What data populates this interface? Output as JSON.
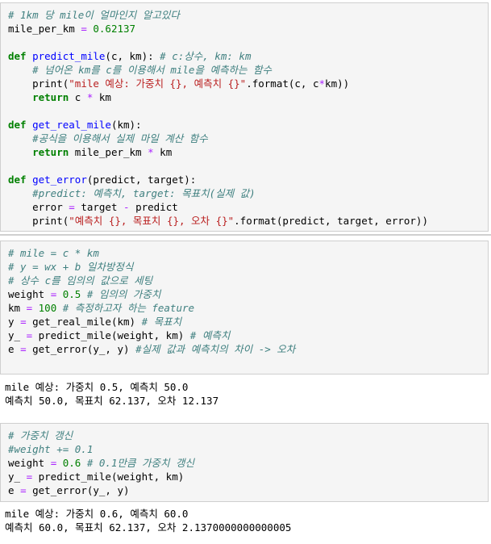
{
  "cells": [
    {
      "lines": [
        [
          {
            "t": "# 1km 당 mile이 얼마인지 알고있다",
            "c": "c"
          }
        ],
        [
          {
            "t": "mile_per_km ",
            "c": ""
          },
          {
            "t": "=",
            "c": "o"
          },
          {
            "t": " ",
            "c": ""
          },
          {
            "t": "0.62137",
            "c": "num"
          }
        ],
        [
          {
            "t": "",
            "c": ""
          }
        ],
        [
          {
            "t": "def",
            "c": "k"
          },
          {
            "t": " ",
            "c": ""
          },
          {
            "t": "predict_mile",
            "c": "n"
          },
          {
            "t": "(c, km): ",
            "c": ""
          },
          {
            "t": "# c:상수, km: km",
            "c": "c"
          }
        ],
        [
          {
            "t": "    ",
            "c": ""
          },
          {
            "t": "# 넘어온 km를 c를 이용해서 mile을 예측하는 함수",
            "c": "c"
          }
        ],
        [
          {
            "t": "    print(",
            "c": ""
          },
          {
            "t": "\"mile 예상: 가중치 {}, 예측치 {}\"",
            "c": "s"
          },
          {
            "t": ".format(c, c",
            "c": ""
          },
          {
            "t": "*",
            "c": "o"
          },
          {
            "t": "km))",
            "c": ""
          }
        ],
        [
          {
            "t": "    ",
            "c": ""
          },
          {
            "t": "return",
            "c": "k"
          },
          {
            "t": " c ",
            "c": ""
          },
          {
            "t": "*",
            "c": "o"
          },
          {
            "t": " km",
            "c": ""
          }
        ],
        [
          {
            "t": "",
            "c": ""
          }
        ],
        [
          {
            "t": "def",
            "c": "k"
          },
          {
            "t": " ",
            "c": ""
          },
          {
            "t": "get_real_mile",
            "c": "n"
          },
          {
            "t": "(km):",
            "c": ""
          }
        ],
        [
          {
            "t": "    ",
            "c": ""
          },
          {
            "t": "#공식을 이용해서 실제 마일 계산 함수",
            "c": "c"
          }
        ],
        [
          {
            "t": "    ",
            "c": ""
          },
          {
            "t": "return",
            "c": "k"
          },
          {
            "t": " mile_per_km ",
            "c": ""
          },
          {
            "t": "*",
            "c": "o"
          },
          {
            "t": " km",
            "c": ""
          }
        ],
        [
          {
            "t": "",
            "c": ""
          }
        ],
        [
          {
            "t": "def",
            "c": "k"
          },
          {
            "t": " ",
            "c": ""
          },
          {
            "t": "get_error",
            "c": "n"
          },
          {
            "t": "(predict, target):",
            "c": ""
          }
        ],
        [
          {
            "t": "    ",
            "c": ""
          },
          {
            "t": "#predict: 예측치, target: 목표치(실제 값)",
            "c": "c"
          }
        ],
        [
          {
            "t": "    error ",
            "c": ""
          },
          {
            "t": "=",
            "c": "o"
          },
          {
            "t": " target ",
            "c": ""
          },
          {
            "t": "-",
            "c": "o"
          },
          {
            "t": " predict",
            "c": ""
          }
        ],
        [
          {
            "t": "    print(",
            "c": ""
          },
          {
            "t": "\"예측치 {}, 목표치 {}, 오차 {}\"",
            "c": "s"
          },
          {
            "t": ".format(predict, target, error))",
            "c": ""
          }
        ]
      ],
      "output": []
    },
    {
      "lines": [
        [
          {
            "t": "# mile = c * km",
            "c": "c"
          }
        ],
        [
          {
            "t": "# y = wx + b 일차방정식",
            "c": "c"
          }
        ],
        [
          {
            "t": "# 상수 c를 임의의 값으로 세팅",
            "c": "c"
          }
        ],
        [
          {
            "t": "weight ",
            "c": ""
          },
          {
            "t": "=",
            "c": "o"
          },
          {
            "t": " ",
            "c": ""
          },
          {
            "t": "0.5",
            "c": "num"
          },
          {
            "t": " ",
            "c": ""
          },
          {
            "t": "# 임의의 가중치",
            "c": "c"
          }
        ],
        [
          {
            "t": "km ",
            "c": ""
          },
          {
            "t": "=",
            "c": "o"
          },
          {
            "t": " ",
            "c": ""
          },
          {
            "t": "100",
            "c": "num"
          },
          {
            "t": " ",
            "c": ""
          },
          {
            "t": "# 측정하고자 하는 feature",
            "c": "c"
          }
        ],
        [
          {
            "t": "y ",
            "c": ""
          },
          {
            "t": "=",
            "c": "o"
          },
          {
            "t": " get_real_mile(km) ",
            "c": ""
          },
          {
            "t": "# 목표치",
            "c": "c"
          }
        ],
        [
          {
            "t": "y_ ",
            "c": ""
          },
          {
            "t": "=",
            "c": "o"
          },
          {
            "t": " predict_mile(weight, km) ",
            "c": ""
          },
          {
            "t": "# 예측치",
            "c": "c"
          }
        ],
        [
          {
            "t": "e ",
            "c": ""
          },
          {
            "t": "=",
            "c": "o"
          },
          {
            "t": " get_error(y_, y) ",
            "c": ""
          },
          {
            "t": "#실제 값과 예측치의 차이 -> 오차",
            "c": "c"
          }
        ]
      ],
      "output": [
        "mile 예상: 가중치 0.5, 예측치 50.0",
        "예측치 50.0, 목표치 62.137, 오차 12.137"
      ]
    },
    {
      "lines": [
        [
          {
            "t": "# 가중치 갱신",
            "c": "c"
          }
        ],
        [
          {
            "t": "#weight += 0.1",
            "c": "c"
          }
        ],
        [
          {
            "t": "weight ",
            "c": ""
          },
          {
            "t": "=",
            "c": "o"
          },
          {
            "t": " ",
            "c": ""
          },
          {
            "t": "0.6",
            "c": "num"
          },
          {
            "t": " ",
            "c": ""
          },
          {
            "t": "# 0.1만큼 가중치 갱신",
            "c": "c"
          }
        ],
        [
          {
            "t": "y_ ",
            "c": ""
          },
          {
            "t": "=",
            "c": "o"
          },
          {
            "t": " predict_mile(weight, km)",
            "c": ""
          }
        ],
        [
          {
            "t": "e ",
            "c": ""
          },
          {
            "t": "=",
            "c": "o"
          },
          {
            "t": " get_error(y_, y)",
            "c": ""
          }
        ]
      ],
      "output": [
        "mile 예상: 가중치 0.6, 예측치 60.0",
        "예측치 60.0, 목표치 62.137, 오차 2.1370000000000005"
      ]
    }
  ]
}
